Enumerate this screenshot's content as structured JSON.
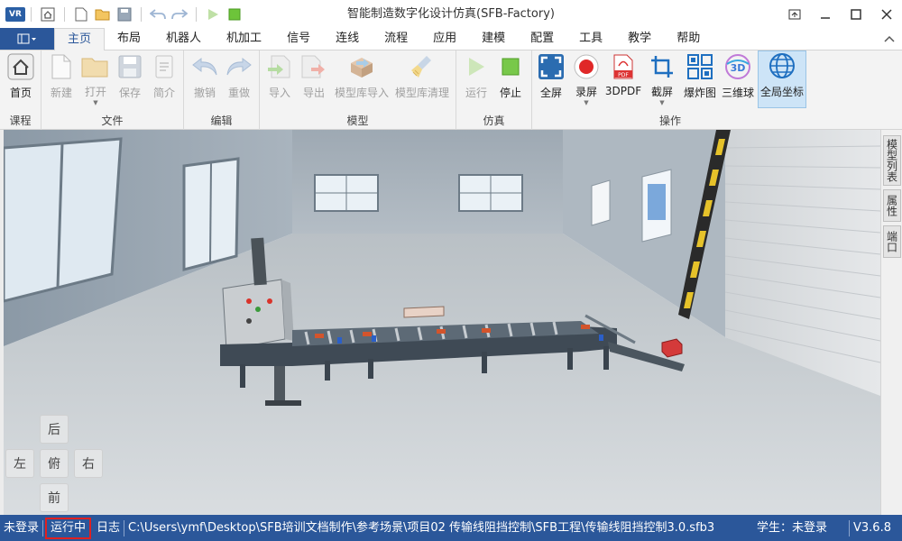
{
  "titlebar": {
    "title": "智能制造数字化设计仿真(SFB-Factory)",
    "logo_text": "VR"
  },
  "tabs": [
    {
      "label": "主页",
      "active": true
    },
    {
      "label": "布局"
    },
    {
      "label": "机器人"
    },
    {
      "label": "机加工"
    },
    {
      "label": "信号"
    },
    {
      "label": "连线"
    },
    {
      "label": "流程"
    },
    {
      "label": "应用"
    },
    {
      "label": "建模"
    },
    {
      "label": "配置"
    },
    {
      "label": "工具"
    },
    {
      "label": "教学"
    },
    {
      "label": "帮助"
    }
  ],
  "ribbon": {
    "groups": {
      "course": "课程",
      "file": "文件",
      "edit": "编辑",
      "model": "模型",
      "sim": "仿真",
      "ops": "操作"
    },
    "buttons": {
      "home": "首页",
      "new": "新建",
      "open": "打开",
      "save": "保存",
      "brief": "简介",
      "undo": "撤销",
      "redo": "重做",
      "import": "导入",
      "export": "导出",
      "lib_import": "模型库导入",
      "lib_clean": "模型库清理",
      "run": "运行",
      "stop": "停止",
      "fullscreen": "全屏",
      "record": "录屏",
      "pdf3d": "3DPDF",
      "screenshot": "截屏",
      "explode": "爆炸图",
      "ball3d": "三维球",
      "global_coord": "全局坐标"
    }
  },
  "side_panel": [
    "模型列表",
    "属性",
    "端口"
  ],
  "nav_pad": {
    "up": "后",
    "left": "左",
    "center": "俯",
    "right": "右",
    "down": "前"
  },
  "statusbar": {
    "login": "未登录",
    "running": "运行中",
    "log": "日志",
    "path": "C:\\Users\\ymf\\Desktop\\SFB培训文档制作\\参考场景\\项目02 传输线阻挡控制\\SFB工程\\传输线阻挡控制3.0.sfb3",
    "student": "学生：未登录",
    "version": "V3.6.8"
  },
  "colors": {
    "accent": "#2b579a",
    "running_highlight": "#e02020",
    "active_button_bg": "#cde4f7"
  }
}
